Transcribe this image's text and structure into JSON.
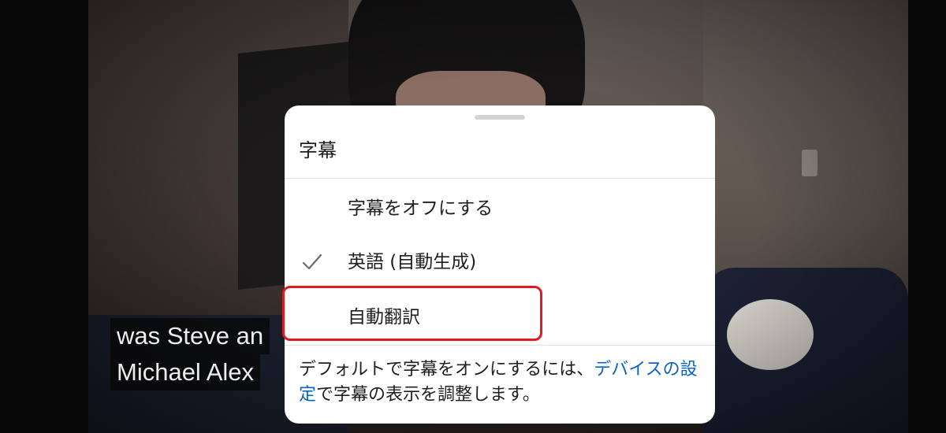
{
  "video": {
    "captions": [
      "was Steve an",
      "Michael Alex"
    ]
  },
  "sheet": {
    "title": "字幕",
    "items": [
      {
        "label": "字幕をオフにする",
        "selected": false
      },
      {
        "label": "英語 (自動生成)",
        "selected": true
      },
      {
        "label": "自動翻訳",
        "selected": false,
        "highlighted": true
      }
    ],
    "footer": {
      "text_before": "デフォルトで字幕をオンにするには、",
      "link_text": "デバイスの設定",
      "text_after": "で字幕の表示を調整します。"
    }
  },
  "colors": {
    "link": "#0b63c7",
    "highlight": "#e11a1f"
  },
  "icons": [
    "check-icon"
  ]
}
